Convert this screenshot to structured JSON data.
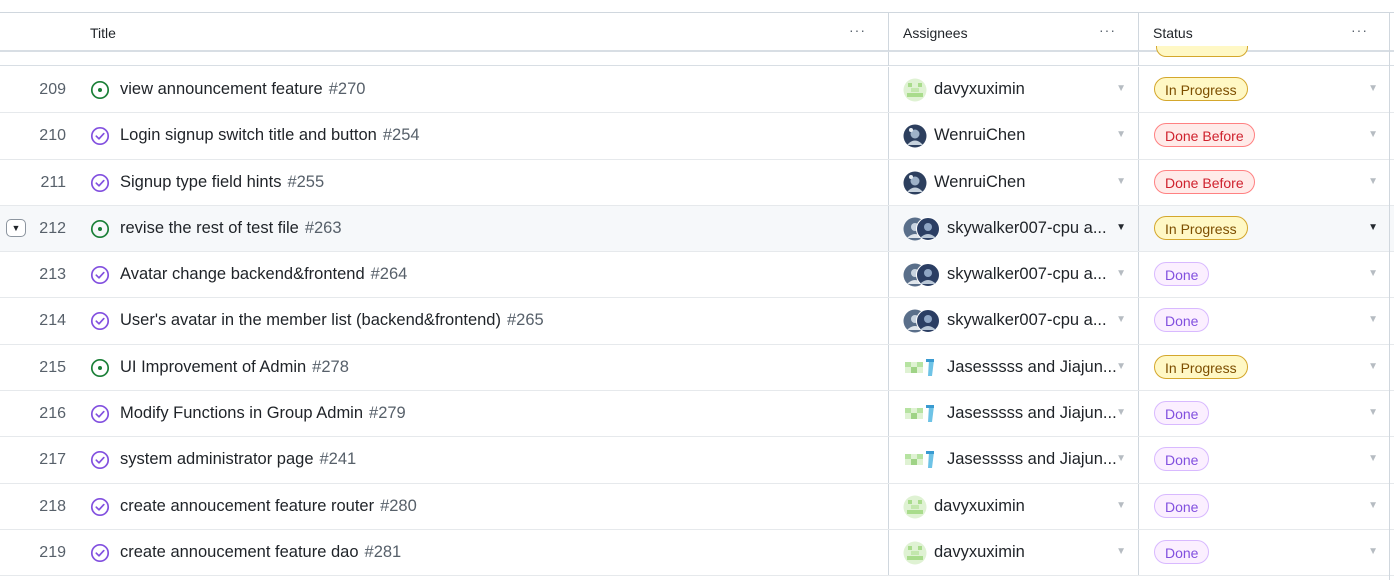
{
  "header": {
    "title_label": "Title",
    "assignees_label": "Assignees",
    "status_label": "Status",
    "menu_glyph": "···"
  },
  "colors": {
    "open_issue": "#1a7f37",
    "closed_issue": "#8250df",
    "in_progress": "#d4a72c",
    "done_before": "#cf222e",
    "done": "#8250df"
  },
  "rows": [
    {
      "num": "209",
      "state": "open",
      "title": "view announcement feature",
      "issue": "#270",
      "assignee": "davyxuximin",
      "avatar": "avatar-green",
      "status": "In Progress",
      "status_kind": "progress"
    },
    {
      "num": "210",
      "state": "closed",
      "title": "Login signup switch title and button",
      "issue": "#254",
      "assignee": "WenruiChen",
      "avatar": "avatar-photo",
      "status": "Done Before",
      "status_kind": "donebefore"
    },
    {
      "num": "211",
      "state": "closed",
      "title": "Signup type field hints",
      "issue": "#255",
      "assignee": "WenruiChen",
      "avatar": "avatar-photo",
      "status": "Done Before",
      "status_kind": "donebefore"
    },
    {
      "num": "212",
      "state": "open",
      "title": "revise the rest of test file",
      "issue": "#263",
      "assignee": "skywalker007-cpu a...",
      "avatar": "avatar-pair-photo",
      "status": "In Progress",
      "status_kind": "progress",
      "highlight": true
    },
    {
      "num": "213",
      "state": "closed",
      "title": "Avatar change backend&frontend",
      "issue": "#264",
      "assignee": "skywalker007-cpu a...",
      "avatar": "avatar-pair-photo",
      "status": "Done",
      "status_kind": "done"
    },
    {
      "num": "214",
      "state": "closed",
      "title": "User's avatar in the member list (backend&frontend)",
      "issue": "#265",
      "assignee": "skywalker007-cpu a...",
      "avatar": "avatar-pair-photo",
      "status": "Done",
      "status_kind": "done"
    },
    {
      "num": "215",
      "state": "open",
      "title": "UI Improvement of Admin",
      "issue": "#278",
      "assignee": "Jasesssss and Jiajun...",
      "avatar": "avatar-pair-pixel",
      "status": "In Progress",
      "status_kind": "progress"
    },
    {
      "num": "216",
      "state": "closed",
      "title": "Modify Functions in Group Admin",
      "issue": "#279",
      "assignee": "Jasesssss and Jiajun...",
      "avatar": "avatar-pair-pixel",
      "status": "Done",
      "status_kind": "done"
    },
    {
      "num": "217",
      "state": "closed",
      "title": "system administrator page",
      "issue": "#241",
      "assignee": "Jasesssss and Jiajun...",
      "avatar": "avatar-pair-pixel",
      "status": "Done",
      "status_kind": "done"
    },
    {
      "num": "218",
      "state": "closed",
      "title": "create annoucement feature router",
      "issue": "#280",
      "assignee": "davyxuximin",
      "avatar": "avatar-green",
      "status": "Done",
      "status_kind": "done"
    },
    {
      "num": "219",
      "state": "closed",
      "title": "create annoucement feature dao",
      "issue": "#281",
      "assignee": "davyxuximin",
      "avatar": "avatar-green",
      "status": "Done",
      "status_kind": "done"
    }
  ]
}
